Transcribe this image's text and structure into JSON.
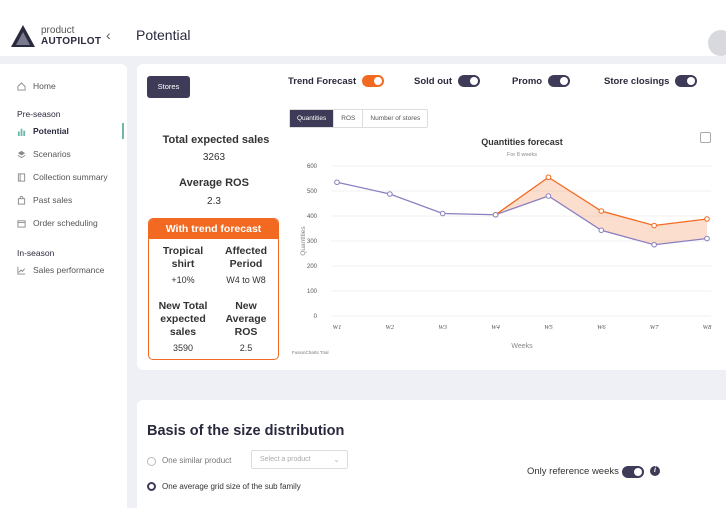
{
  "app": {
    "brand_line1": "product",
    "brand_line2": "AUTOPILOT",
    "page_title": "Potential"
  },
  "sidebar": {
    "home": "Home",
    "preseason": "Pre-season",
    "items_pre": [
      {
        "label": "Potential",
        "icon": "bar-chart-icon"
      },
      {
        "label": "Scenarios",
        "icon": "layers-icon"
      },
      {
        "label": "Collection summary",
        "icon": "book-icon"
      },
      {
        "label": "Past sales",
        "icon": "bag-icon"
      },
      {
        "label": "Order scheduling",
        "icon": "calendar-icon"
      }
    ],
    "inseason": "In-season",
    "items_in": [
      {
        "label": "Sales performance",
        "icon": "line-chart-icon"
      }
    ]
  },
  "controls": {
    "stores_button": "Stores",
    "toggles": [
      {
        "label": "Trend Forecast",
        "color": "#f26a21"
      },
      {
        "label": "Sold out",
        "color": "#3d3b58"
      },
      {
        "label": "Promo",
        "color": "#3d3b58"
      },
      {
        "label": "Store closings",
        "color": "#3d3b58"
      }
    ],
    "tabs": [
      "Quantities",
      "ROS",
      "Number of stores"
    ]
  },
  "stats": {
    "total_sales_label": "Total expected sales",
    "total_sales_value": "3263",
    "avg_ros_label": "Average ROS",
    "avg_ros_value": "2.3"
  },
  "trend_box": {
    "title": "With trend forecast",
    "c1_label": "Tropical shirt",
    "c1_value": "+10%",
    "c2_label": "Affected Period",
    "c2_value": "W4 to W8",
    "c3_label": "New Total expected sales",
    "c3_value": "3590",
    "c4_label": "New Average ROS",
    "c4_value": "2.5"
  },
  "chart_data": {
    "type": "line",
    "title": "Quantities forecast",
    "subtitle": "For 8 weeks",
    "xlabel": "Weeks",
    "ylabel": "Quantities",
    "credit": "FusionCharts Trial",
    "categories": [
      "W1",
      "W2",
      "W3",
      "W4",
      "W5",
      "W6",
      "W7",
      "W8"
    ],
    "yticks": [
      "0",
      "100",
      "200",
      "300",
      "400",
      "500",
      "600"
    ],
    "ylim": [
      0,
      600
    ],
    "series": [
      {
        "values": [
          535,
          488,
          410,
          405,
          480,
          343,
          285,
          310
        ],
        "color": "#8b7fc0"
      },
      {
        "values": [
          null,
          null,
          null,
          405,
          555,
          420,
          362,
          388
        ],
        "color": "#f26a21"
      }
    ]
  },
  "size_section": {
    "title": "Basis of the size distribution",
    "option1": "One similar product",
    "select_placeholder": "Select a product",
    "option2": "One average grid size of the sub family",
    "ref_weeks": "Only reference weeks"
  }
}
